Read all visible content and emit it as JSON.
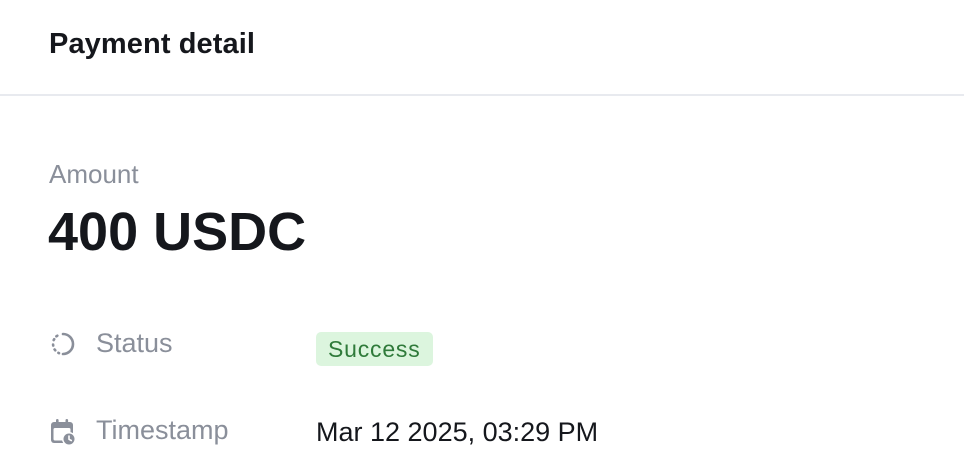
{
  "header": {
    "title": "Payment detail"
  },
  "amount": {
    "label": "Amount",
    "value": "400 USDC"
  },
  "details": {
    "status": {
      "label": "Status",
      "icon": "loading-circle-icon",
      "value": "Success",
      "badge_bg": "#dcf5de",
      "badge_fg": "#2f7a3a"
    },
    "timestamp": {
      "label": "Timestamp",
      "icon": "calendar-clock-icon",
      "value": "Mar 12 2025, 03:29 PM"
    }
  },
  "colors": {
    "primary_text": "#15171c",
    "muted_text": "#8a8f9a",
    "divider": "#e8eaef"
  }
}
